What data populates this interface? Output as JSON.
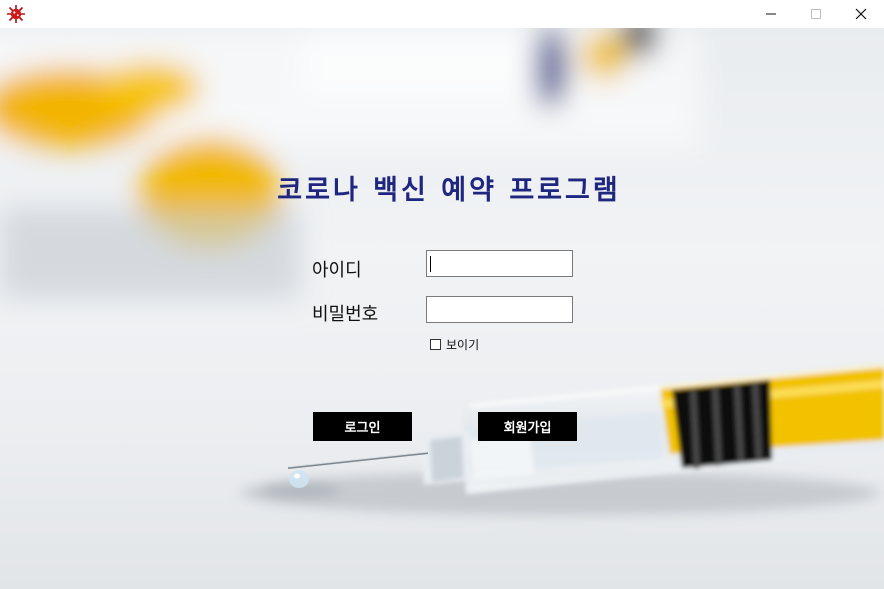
{
  "window": {
    "title": "",
    "icon": "virus-icon",
    "controls": [
      "minimize-icon",
      "maximize-icon",
      "close-icon"
    ]
  },
  "login": {
    "title": "코로나 백신 예약 프로그램",
    "id_label": "아이디",
    "id_value": "",
    "password_label": "비밀번호",
    "password_value": "",
    "show_password_label": "보이기",
    "show_password_checked": false,
    "login_button": "로그인",
    "signup_button": "회원가입"
  },
  "colors": {
    "title_text": "#1e2680",
    "button_bg": "#000000",
    "button_text": "#ffffff",
    "syringe_liquid": "#f2c200"
  }
}
